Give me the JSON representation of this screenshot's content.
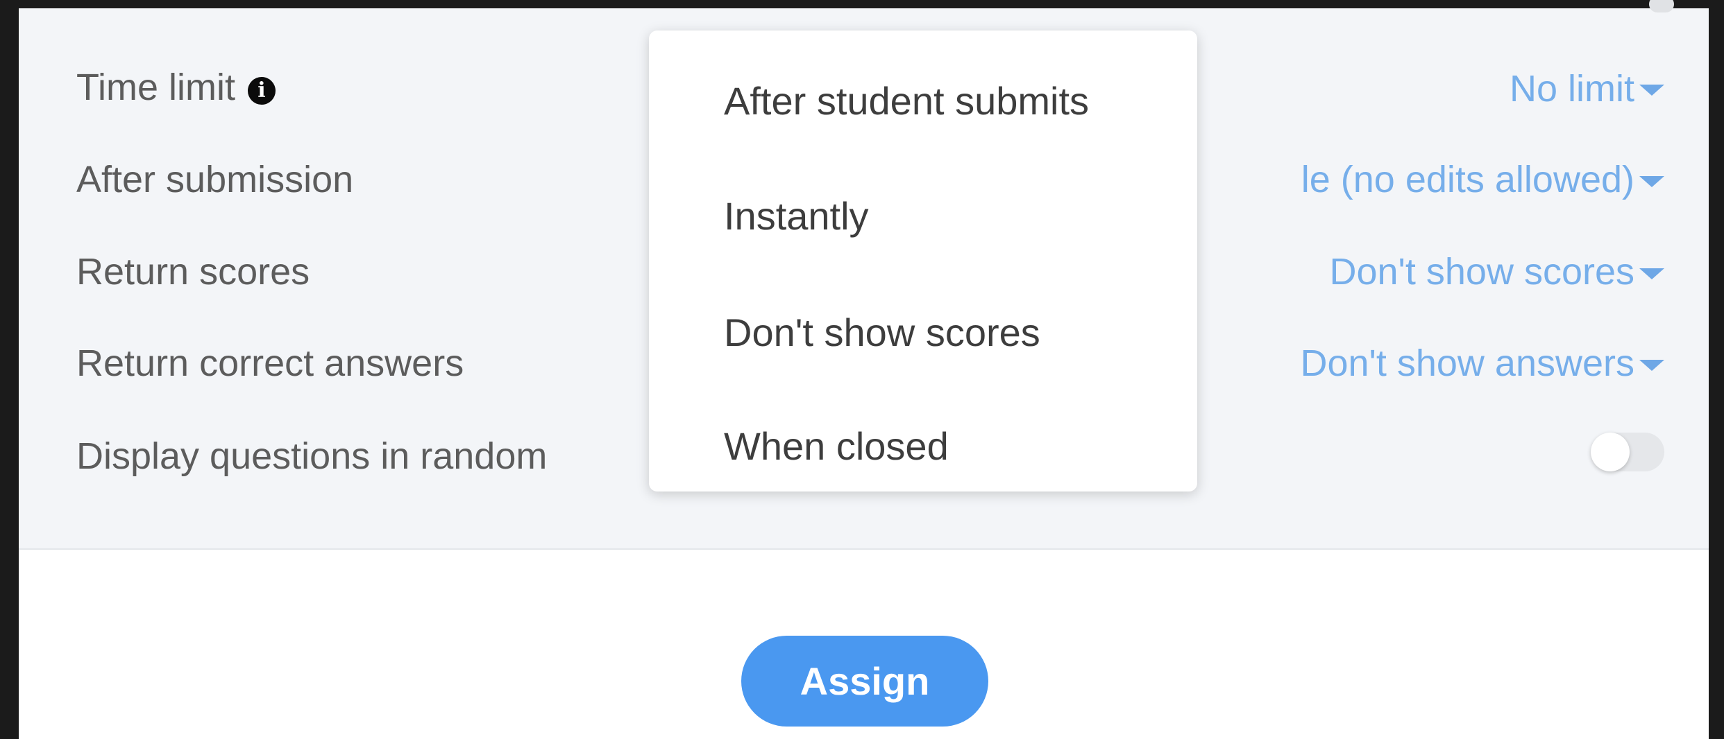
{
  "settings": {
    "time_limit": {
      "label": "Time limit",
      "value": "No limit"
    },
    "after_submission": {
      "label": "After submission",
      "value": "le (no edits allowed)"
    },
    "return_scores": {
      "label": "Return scores",
      "value": "Don't show scores"
    },
    "return_correct_answers": {
      "label": "Return correct answers",
      "value": "Don't show answers"
    },
    "random_order": {
      "label": "Display questions in random",
      "enabled": false
    }
  },
  "menu": {
    "items": [
      "After student submits",
      "Instantly",
      "Don't show scores",
      "When closed"
    ]
  },
  "actions": {
    "assign_label": "Assign"
  },
  "icons": {
    "info": "info-icon",
    "caret": "caret-down-icon"
  },
  "colors": {
    "link": "#76aeea",
    "primary": "#4a98f0",
    "panel_bg": "#f3f5f8"
  }
}
